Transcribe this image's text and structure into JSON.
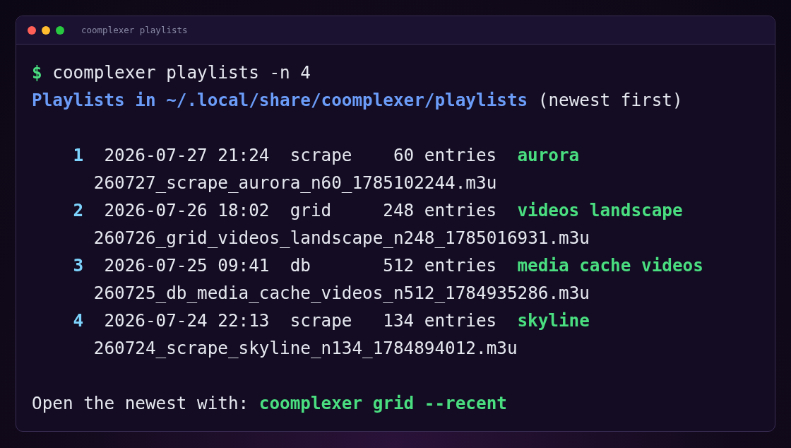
{
  "window": {
    "title": "coomplexer playlists"
  },
  "command": {
    "prompt": "$",
    "text": "coomplexer playlists -n 4"
  },
  "heading": {
    "path": "Playlists in ~/.local/share/coomplexer/playlists",
    "note": "(newest first)"
  },
  "playlists": [
    {
      "index": "1",
      "date": "2026-07-27 21:24",
      "source": "scrape",
      "entries": "60 entries",
      "label": "aurora",
      "file": "260727_scrape_aurora_n60_1785102244.m3u"
    },
    {
      "index": "2",
      "date": "2026-07-26 18:02",
      "source": "grid",
      "entries": "248 entries",
      "label": "videos landscape",
      "file": "260726_grid_videos_landscape_n248_1785016931.m3u"
    },
    {
      "index": "3",
      "date": "2026-07-25 09:41",
      "source": "db",
      "entries": "512 entries",
      "label": "media cache videos",
      "file": "260725_db_media_cache_videos_n512_1784935286.m3u"
    },
    {
      "index": "4",
      "date": "2026-07-24 22:13",
      "source": "scrape",
      "entries": "134 entries",
      "label": "skyline",
      "file": "260724_scrape_skyline_n134_1784894012.m3u"
    }
  ],
  "footer": {
    "text": "Open the newest with:",
    "command": "coomplexer grid --recent"
  }
}
